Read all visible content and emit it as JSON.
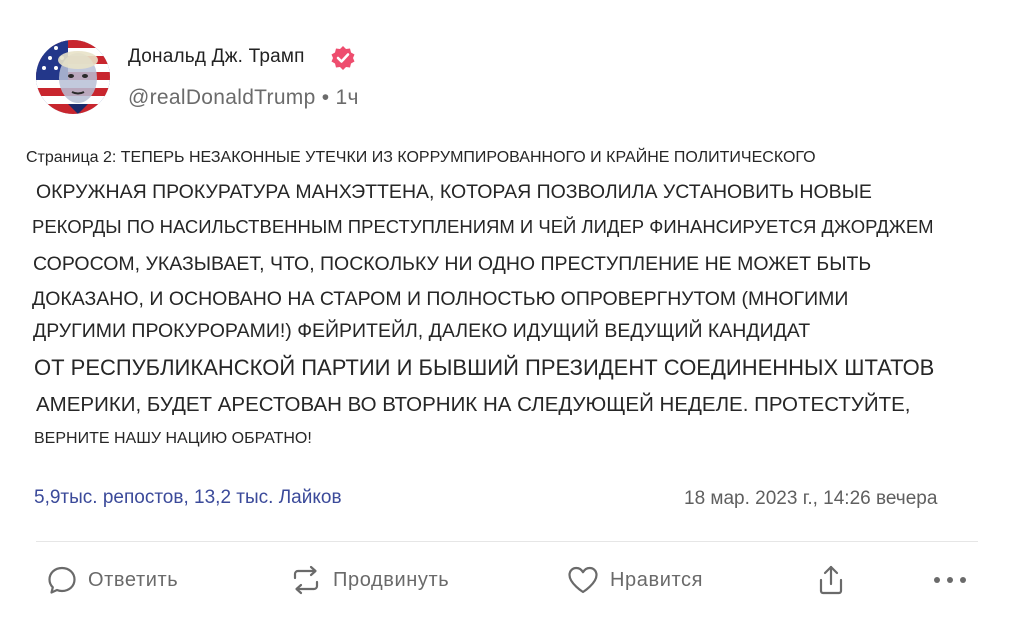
{
  "author": {
    "name": "Дональд Дж. Трамп",
    "handle": "@realDonaldTrump",
    "time": "1ч",
    "separator": "•"
  },
  "post": {
    "lines": [
      "Страница 2: ТЕПЕРЬ НЕЗАКОННЫЕ УТЕЧКИ ИЗ КОРРУМПИРОВАННОГО И КРАЙНЕ ПОЛИТИЧЕСКОГО",
      "ОКРУЖНАЯ ПРОКУРАТУРА МАНХЭТТЕНА, КОТОРАЯ ПОЗВОЛИЛА УСТАНОВИТЬ НОВЫЕ",
      "РЕКОРДЫ ПО НАСИЛЬСТВЕННЫМ ПРЕСТУПЛЕНИЯМ И ЧЕЙ ЛИДЕР ФИНАНСИРУЕТСЯ ДЖОРДЖЕМ",
      "СОРОСОМ, УКАЗЫВАЕТ, ЧТО, ПОСКОЛЬКУ НИ ОДНО ПРЕСТУПЛЕНИЕ НЕ МОЖЕТ БЫТЬ",
      "ДОКАЗАНО, И ОСНОВАНО НА СТАРОМ И ПОЛНОСТЬЮ ОПРОВЕРГНУТОМ (МНОГИМИ",
      "ДРУГИМИ ПРОКУРОРАМИ!) ФЕЙРИТЕЙЛ, ДАЛЕКО ИДУЩИЙ ВЕДУЩИЙ КАНДИДАТ",
      "ОТ РЕСПУБЛИКАНСКОЙ ПАРТИИ И БЫВШИЙ ПРЕЗИДЕНТ СОЕДИНЕННЫХ ШТАТОВ",
      "АМЕРИКИ, БУДЕТ АРЕСТОВАН ВО ВТОРНИК НА СЛЕДУЮЩЕЙ НЕДЕЛЕ. ПРОТЕСТУЙТЕ,",
      "ВЕРНИТЕ НАШУ НАЦИЮ ОБРАТНО!"
    ]
  },
  "stats": "5,9тыс. репостов, 13,2 тыс. Лайков",
  "date": "18 мар. 2023 г., 14:26 вечера",
  "actions": {
    "reply": "Ответить",
    "repost": "Продвинуть",
    "like": "Нравится"
  },
  "icons": {
    "verified": "verified-badge-icon",
    "reply": "speech-bubble-icon",
    "repost": "repost-arrows-icon",
    "like": "heart-icon",
    "share": "share-icon",
    "more": "more-dots-icon"
  },
  "colors": {
    "verified": "#ee4d6e",
    "stats": "#3b4a9a",
    "icon": "#6a6a6a"
  }
}
